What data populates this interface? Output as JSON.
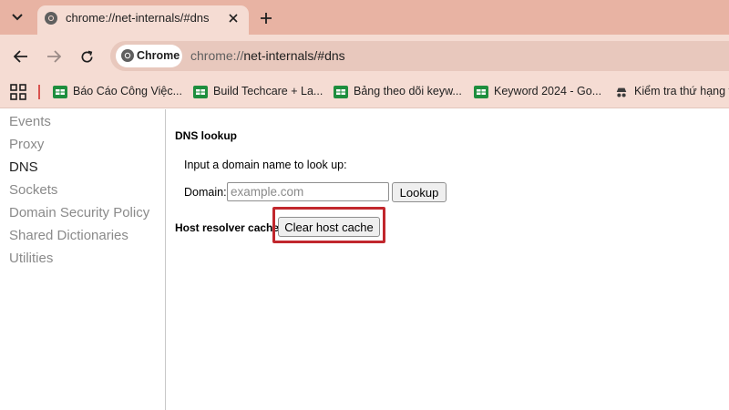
{
  "browser": {
    "tab": {
      "title": "chrome://net-internals/#dns",
      "favicon": "chrome-globe-icon"
    },
    "toolbar": {
      "chip_label": "Chrome",
      "url_scheme": "chrome://",
      "url_rest": "net-internals/#dns"
    },
    "bookmarks": [
      {
        "label": "Báo Cáo Công Việc...",
        "icon": "sheets-icon"
      },
      {
        "label": "Build Techcare + La...",
        "icon": "sheets-icon"
      },
      {
        "label": "Bảng theo dõi keyw...",
        "icon": "sheets-icon"
      },
      {
        "label": "Keyword 2024 - Go...",
        "icon": "sheets-icon"
      },
      {
        "label": "Kiểm tra thứ hạng t",
        "icon": "incognito-icon"
      }
    ]
  },
  "sidebar": {
    "items": [
      {
        "label": "Events",
        "active": false
      },
      {
        "label": "Proxy",
        "active": false
      },
      {
        "label": "DNS",
        "active": true
      },
      {
        "label": "Sockets",
        "active": false
      },
      {
        "label": "Domain Security Policy",
        "active": false
      },
      {
        "label": "Shared Dictionaries",
        "active": false
      },
      {
        "label": "Utilities",
        "active": false
      }
    ]
  },
  "main": {
    "dns_lookup_heading": "DNS lookup",
    "prompt": "Input a domain name to look up:",
    "domain_label": "Domain:",
    "domain_placeholder": "example.com",
    "domain_value": "",
    "lookup_button": "Lookup",
    "host_cache_heading": "Host resolver cache",
    "clear_button": "Clear host cache"
  },
  "colors": {
    "tabstrip": "#e8b3a3",
    "toolbar": "#f5dcd3",
    "highlight": "#c1272d",
    "sheets_green": "#1e8e3e"
  }
}
